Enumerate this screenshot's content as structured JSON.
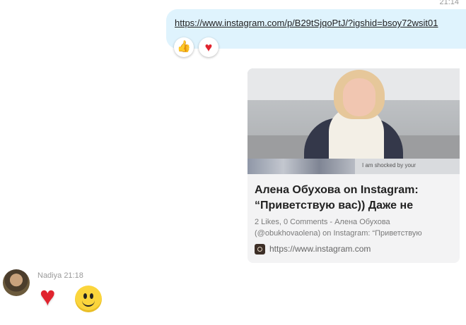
{
  "outgoing": {
    "timestamp": "21:14",
    "link": "https://www.instagram.com/p/B29tSjqoPtJ/?igshid=bsoy72wsit01",
    "reactions": [
      {
        "icon": "thumbs-up-icon",
        "glyph": "👍"
      },
      {
        "icon": "heart-icon",
        "glyph": "♥"
      }
    ]
  },
  "preview_card": {
    "image_caption": "I am shocked by your",
    "title": "Алена Обухова on Instagram: “Приветствую вас)) Даже не",
    "description": "2 Likes, 0 Comments - Алена Обухова (@obukhovaolena) on Instagram: “Приветствую",
    "source_icon": "instagram-icon",
    "source_url": "https://www.instagram.com"
  },
  "incoming": {
    "sender": "Nadiya",
    "time": "21:18",
    "emoticons": [
      "heart-emoticon",
      "smile-emoticon"
    ]
  }
}
